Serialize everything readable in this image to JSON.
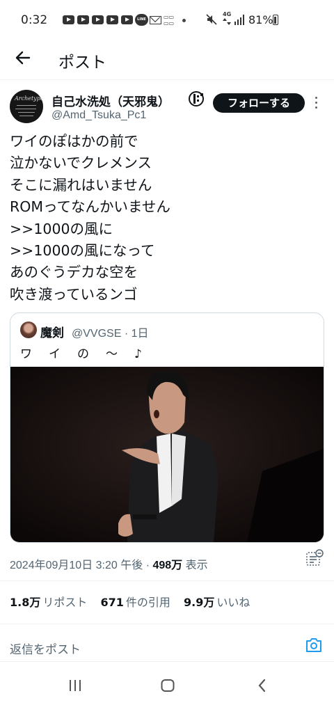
{
  "status_bar": {
    "time": "0:32",
    "line_icon_text": "LINE",
    "network_label": "4G",
    "battery_text": "81%",
    "notification_icons": [
      "youtube-icon",
      "youtube-icon",
      "youtube-icon",
      "youtube-icon",
      "youtube-icon",
      "youtube-icon",
      "line-icon",
      "mail-icon",
      "app-icon"
    ],
    "system_icons": [
      "mute-icon",
      "signal-icon",
      "battery-icon"
    ]
  },
  "header": {
    "title": "ポスト",
    "back_icon": "arrow-left-icon"
  },
  "post": {
    "author": {
      "display_name": "自己水洗処（天邪鬼）",
      "handle": "@Amd_Tsuka_Pc1",
      "avatar_text": "Archetype",
      "follow_label": "フォローする"
    },
    "text_lines": [
      "ワイのぽはかの前で",
      "泣かないでクレメンス",
      "そこに漏れはいません",
      "ROMってなんかいません",
      ">>1000の風に",
      ">>1000の風になって",
      "あのぐうデカな空を",
      "吹き渡っているンゴ"
    ],
    "quote": {
      "display_name": "魔剣",
      "handle": "@VVGSE",
      "separator": "·",
      "age": "1日",
      "text": "ワイの～♪"
    },
    "meta": {
      "date": "2024年09月10日",
      "time": "3:20 午後",
      "separator": "·",
      "views": "498万",
      "views_label": "表示"
    },
    "stats": {
      "reposts": "1.8万",
      "reposts_label": "リポスト",
      "quotes": "671",
      "quotes_label": "件の引用",
      "likes": "9.9万",
      "likes_label": "いいね"
    }
  },
  "reply": {
    "placeholder": "返信をポスト"
  },
  "colors": {
    "accent": "#1d9bf0",
    "text": "#0f1419",
    "muted": "#536471",
    "follow_bg": "#0f1419"
  }
}
